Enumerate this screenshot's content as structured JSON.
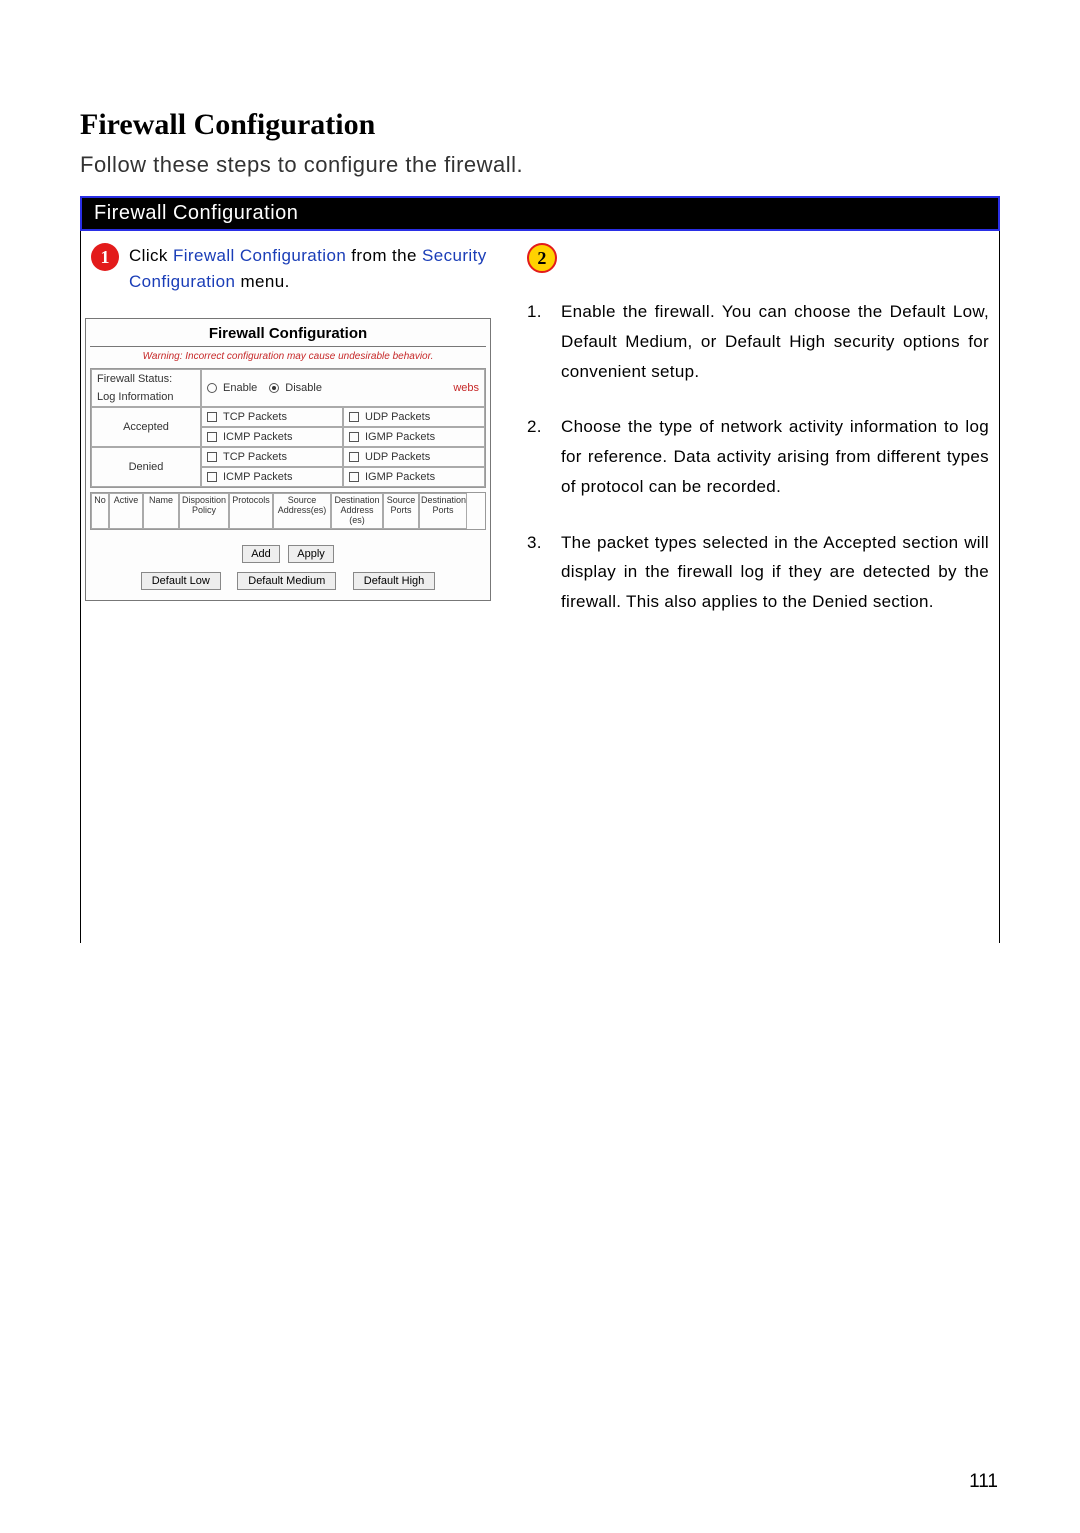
{
  "page_number": "111",
  "title": "Firewall Configuration",
  "intro": "Follow these steps to configure the firewall.",
  "banner": "Firewall Configuration",
  "step1": {
    "num": "1",
    "pre": "Click ",
    "link1": "Firewall Configuration",
    "mid": " from the ",
    "link2": "Security Configuration",
    "post": " menu."
  },
  "step2": {
    "num": "2",
    "items": [
      "Enable the firewall. You can choose the Default Low, Default Medium, or Default High security options for convenient setup.",
      "Choose the type of network activity information to log for reference. Data activity arising from different types of protocol can be recorded.",
      "The packet types selected in the Accepted section will display in the firewall log if they are detected by the firewall. This also applies to the Denied section."
    ]
  },
  "shot": {
    "title": "Firewall Configuration",
    "warning": "Warning: Incorrect configuration may cause undesirable behavior.",
    "status_label": "Firewall Status:",
    "enable": "Enable",
    "disable": "Disable",
    "webs": "webs",
    "loginfo": "Log Information",
    "accepted": "Accepted",
    "denied": "Denied",
    "tcp": "TCP Packets",
    "udp": "UDP Packets",
    "icmp": "ICMP Packets",
    "igmp": "IGMP Packets",
    "cols": [
      "No",
      "Active",
      "Name",
      "Disposition Policy",
      "Protocols",
      "Source Address(es)",
      "Destination Address (es)",
      "Source Ports",
      "Destination Ports"
    ],
    "btn_add": "Add",
    "btn_apply": "Apply",
    "presets": [
      "Default Low",
      "Default Medium",
      "Default High"
    ]
  }
}
